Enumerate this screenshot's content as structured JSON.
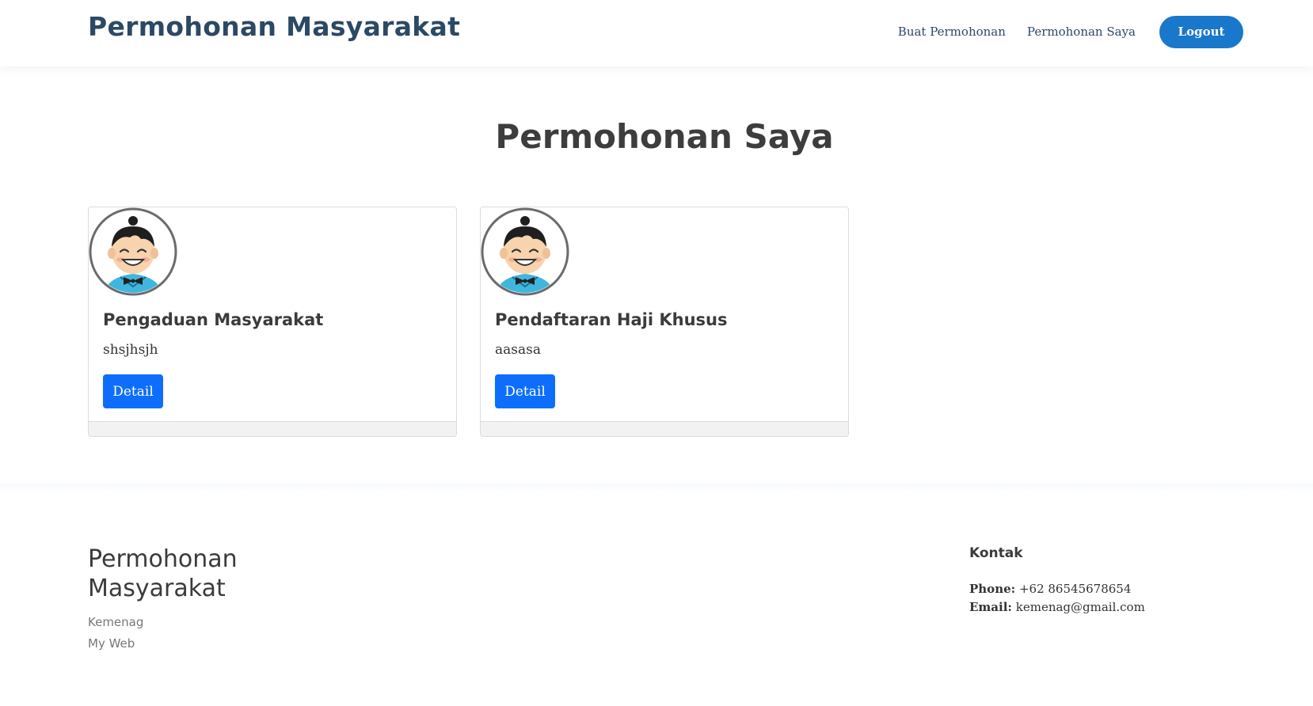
{
  "header": {
    "brand": "Permohonan Masyarakat",
    "nav": {
      "buat_permohonan": "Buat Permohonan",
      "permohonan_saya": "Permohonan Saya",
      "logout": "Logout"
    }
  },
  "main": {
    "title": "Permohonan Saya",
    "cards": [
      {
        "title": "Pengaduan Masyarakat",
        "text": "shsjhsjh",
        "button": "Detail",
        "avatar_icon": "cartoon-boy-avatar"
      },
      {
        "title": "Pendaftaran Haji Khusus",
        "text": "aasasa",
        "button": "Detail",
        "avatar_icon": "cartoon-boy-avatar"
      }
    ]
  },
  "footer": {
    "title": "Permohonan Masyarakat",
    "line1": "Kemenag",
    "line2": "My Web",
    "contact": {
      "heading": "Kontak",
      "phone_label": "Phone:",
      "phone": "+62 86545678654",
      "email_label": "Email:",
      "email": "kemenag@gmail.com"
    }
  },
  "colors": {
    "brand": "#2c4964",
    "logout_button": "#1977cc",
    "detail_button": "#0d6efd"
  }
}
